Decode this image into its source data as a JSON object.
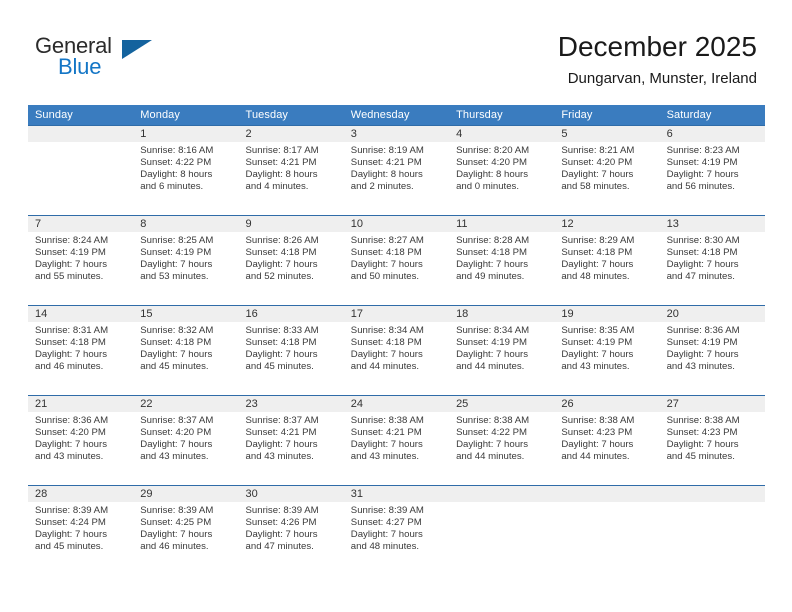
{
  "brand": {
    "name_dark": "General",
    "name_blue": "Blue",
    "color_blue": "#1476c6",
    "color_triangle": "#14639e"
  },
  "header": {
    "title": "December 2025",
    "location": "Dungarvan, Munster, Ireland"
  },
  "theme": {
    "header_bar": "#3a7cbf",
    "row_divider": "#2f6ca8",
    "daynum_band": "#efefef",
    "text": "#333333"
  },
  "weekdays": [
    "Sunday",
    "Monday",
    "Tuesday",
    "Wednesday",
    "Thursday",
    "Friday",
    "Saturday"
  ],
  "weeks": [
    [
      {
        "day": "",
        "sunrise": "",
        "sunset": "",
        "daylight1": "",
        "daylight2": ""
      },
      {
        "day": "1",
        "sunrise": "Sunrise: 8:16 AM",
        "sunset": "Sunset: 4:22 PM",
        "daylight1": "Daylight: 8 hours",
        "daylight2": "and 6 minutes."
      },
      {
        "day": "2",
        "sunrise": "Sunrise: 8:17 AM",
        "sunset": "Sunset: 4:21 PM",
        "daylight1": "Daylight: 8 hours",
        "daylight2": "and 4 minutes."
      },
      {
        "day": "3",
        "sunrise": "Sunrise: 8:19 AM",
        "sunset": "Sunset: 4:21 PM",
        "daylight1": "Daylight: 8 hours",
        "daylight2": "and 2 minutes."
      },
      {
        "day": "4",
        "sunrise": "Sunrise: 8:20 AM",
        "sunset": "Sunset: 4:20 PM",
        "daylight1": "Daylight: 8 hours",
        "daylight2": "and 0 minutes."
      },
      {
        "day": "5",
        "sunrise": "Sunrise: 8:21 AM",
        "sunset": "Sunset: 4:20 PM",
        "daylight1": "Daylight: 7 hours",
        "daylight2": "and 58 minutes."
      },
      {
        "day": "6",
        "sunrise": "Sunrise: 8:23 AM",
        "sunset": "Sunset: 4:19 PM",
        "daylight1": "Daylight: 7 hours",
        "daylight2": "and 56 minutes."
      }
    ],
    [
      {
        "day": "7",
        "sunrise": "Sunrise: 8:24 AM",
        "sunset": "Sunset: 4:19 PM",
        "daylight1": "Daylight: 7 hours",
        "daylight2": "and 55 minutes."
      },
      {
        "day": "8",
        "sunrise": "Sunrise: 8:25 AM",
        "sunset": "Sunset: 4:19 PM",
        "daylight1": "Daylight: 7 hours",
        "daylight2": "and 53 minutes."
      },
      {
        "day": "9",
        "sunrise": "Sunrise: 8:26 AM",
        "sunset": "Sunset: 4:18 PM",
        "daylight1": "Daylight: 7 hours",
        "daylight2": "and 52 minutes."
      },
      {
        "day": "10",
        "sunrise": "Sunrise: 8:27 AM",
        "sunset": "Sunset: 4:18 PM",
        "daylight1": "Daylight: 7 hours",
        "daylight2": "and 50 minutes."
      },
      {
        "day": "11",
        "sunrise": "Sunrise: 8:28 AM",
        "sunset": "Sunset: 4:18 PM",
        "daylight1": "Daylight: 7 hours",
        "daylight2": "and 49 minutes."
      },
      {
        "day": "12",
        "sunrise": "Sunrise: 8:29 AM",
        "sunset": "Sunset: 4:18 PM",
        "daylight1": "Daylight: 7 hours",
        "daylight2": "and 48 minutes."
      },
      {
        "day": "13",
        "sunrise": "Sunrise: 8:30 AM",
        "sunset": "Sunset: 4:18 PM",
        "daylight1": "Daylight: 7 hours",
        "daylight2": "and 47 minutes."
      }
    ],
    [
      {
        "day": "14",
        "sunrise": "Sunrise: 8:31 AM",
        "sunset": "Sunset: 4:18 PM",
        "daylight1": "Daylight: 7 hours",
        "daylight2": "and 46 minutes."
      },
      {
        "day": "15",
        "sunrise": "Sunrise: 8:32 AM",
        "sunset": "Sunset: 4:18 PM",
        "daylight1": "Daylight: 7 hours",
        "daylight2": "and 45 minutes."
      },
      {
        "day": "16",
        "sunrise": "Sunrise: 8:33 AM",
        "sunset": "Sunset: 4:18 PM",
        "daylight1": "Daylight: 7 hours",
        "daylight2": "and 45 minutes."
      },
      {
        "day": "17",
        "sunrise": "Sunrise: 8:34 AM",
        "sunset": "Sunset: 4:18 PM",
        "daylight1": "Daylight: 7 hours",
        "daylight2": "and 44 minutes."
      },
      {
        "day": "18",
        "sunrise": "Sunrise: 8:34 AM",
        "sunset": "Sunset: 4:19 PM",
        "daylight1": "Daylight: 7 hours",
        "daylight2": "and 44 minutes."
      },
      {
        "day": "19",
        "sunrise": "Sunrise: 8:35 AM",
        "sunset": "Sunset: 4:19 PM",
        "daylight1": "Daylight: 7 hours",
        "daylight2": "and 43 minutes."
      },
      {
        "day": "20",
        "sunrise": "Sunrise: 8:36 AM",
        "sunset": "Sunset: 4:19 PM",
        "daylight1": "Daylight: 7 hours",
        "daylight2": "and 43 minutes."
      }
    ],
    [
      {
        "day": "21",
        "sunrise": "Sunrise: 8:36 AM",
        "sunset": "Sunset: 4:20 PM",
        "daylight1": "Daylight: 7 hours",
        "daylight2": "and 43 minutes."
      },
      {
        "day": "22",
        "sunrise": "Sunrise: 8:37 AM",
        "sunset": "Sunset: 4:20 PM",
        "daylight1": "Daylight: 7 hours",
        "daylight2": "and 43 minutes."
      },
      {
        "day": "23",
        "sunrise": "Sunrise: 8:37 AM",
        "sunset": "Sunset: 4:21 PM",
        "daylight1": "Daylight: 7 hours",
        "daylight2": "and 43 minutes."
      },
      {
        "day": "24",
        "sunrise": "Sunrise: 8:38 AM",
        "sunset": "Sunset: 4:21 PM",
        "daylight1": "Daylight: 7 hours",
        "daylight2": "and 43 minutes."
      },
      {
        "day": "25",
        "sunrise": "Sunrise: 8:38 AM",
        "sunset": "Sunset: 4:22 PM",
        "daylight1": "Daylight: 7 hours",
        "daylight2": "and 44 minutes."
      },
      {
        "day": "26",
        "sunrise": "Sunrise: 8:38 AM",
        "sunset": "Sunset: 4:23 PM",
        "daylight1": "Daylight: 7 hours",
        "daylight2": "and 44 minutes."
      },
      {
        "day": "27",
        "sunrise": "Sunrise: 8:38 AM",
        "sunset": "Sunset: 4:23 PM",
        "daylight1": "Daylight: 7 hours",
        "daylight2": "and 45 minutes."
      }
    ],
    [
      {
        "day": "28",
        "sunrise": "Sunrise: 8:39 AM",
        "sunset": "Sunset: 4:24 PM",
        "daylight1": "Daylight: 7 hours",
        "daylight2": "and 45 minutes."
      },
      {
        "day": "29",
        "sunrise": "Sunrise: 8:39 AM",
        "sunset": "Sunset: 4:25 PM",
        "daylight1": "Daylight: 7 hours",
        "daylight2": "and 46 minutes."
      },
      {
        "day": "30",
        "sunrise": "Sunrise: 8:39 AM",
        "sunset": "Sunset: 4:26 PM",
        "daylight1": "Daylight: 7 hours",
        "daylight2": "and 47 minutes."
      },
      {
        "day": "31",
        "sunrise": "Sunrise: 8:39 AM",
        "sunset": "Sunset: 4:27 PM",
        "daylight1": "Daylight: 7 hours",
        "daylight2": "and 48 minutes."
      },
      {
        "day": "",
        "sunrise": "",
        "sunset": "",
        "daylight1": "",
        "daylight2": ""
      },
      {
        "day": "",
        "sunrise": "",
        "sunset": "",
        "daylight1": "",
        "daylight2": ""
      },
      {
        "day": "",
        "sunrise": "",
        "sunset": "",
        "daylight1": "",
        "daylight2": ""
      }
    ]
  ]
}
